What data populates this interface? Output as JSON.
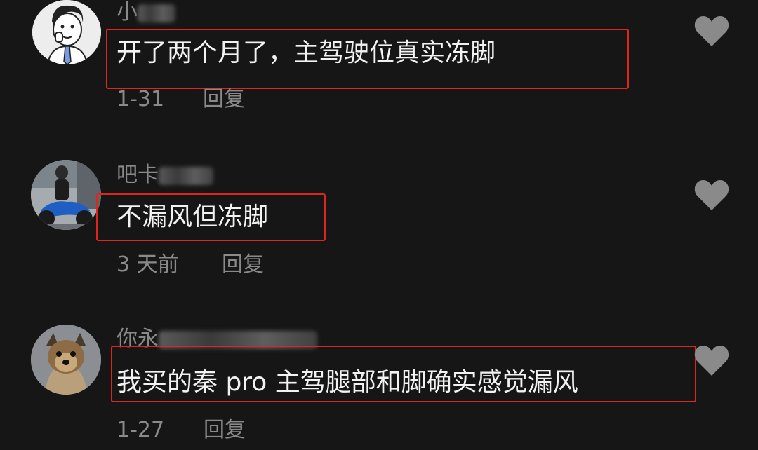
{
  "comments": [
    {
      "username_visible": "小",
      "text": "开了两个月了，主驾驶位真实冻脚",
      "time": "1-31",
      "reply_label": "回复",
      "avatar_icon": "cartoon-boy-avatar-icon",
      "like_icon": "heart-icon"
    },
    {
      "username_visible": "吧卡",
      "text": "不漏风但冻脚",
      "time": "3 天前",
      "reply_label": "回复",
      "avatar_icon": "motorcyclist-avatar-icon",
      "like_icon": "heart-icon"
    },
    {
      "username_visible": "你永",
      "text": "我买的秦 pro 主驾腿部和脚确实感觉漏风",
      "time": "1-27",
      "reply_label": "回复",
      "avatar_icon": "dog-avatar-icon",
      "like_icon": "heart-icon"
    }
  ],
  "colors": {
    "background": "#161616",
    "highlight_border": "#e0251d",
    "secondary_text": "#8a8a8a",
    "primary_text": "#f2f2f2"
  }
}
